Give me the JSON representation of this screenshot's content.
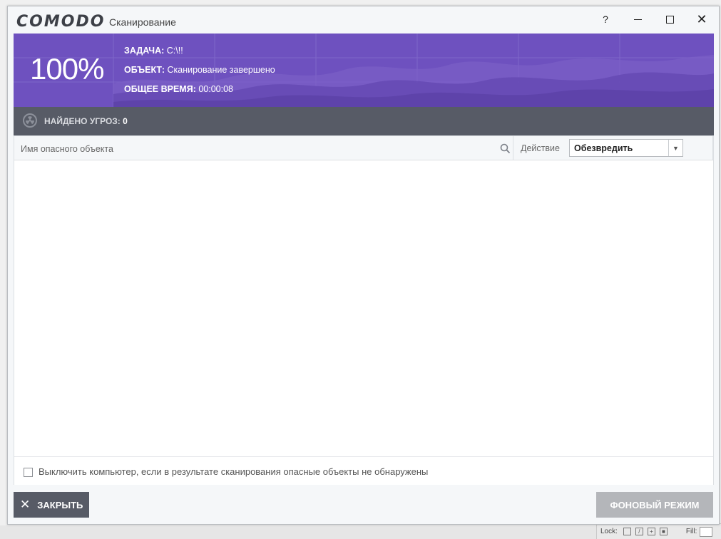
{
  "window": {
    "logo": "COMODO",
    "title": "Сканирование",
    "help": "?",
    "close": "✕"
  },
  "header": {
    "progress_text": "100%",
    "task_label": "ЗАДАЧА:",
    "task_value": "C:\\!!",
    "object_label": "ОБЪЕКТ:",
    "object_value": "Сканирование завершено",
    "time_label": "ОБЩЕЕ ВРЕМЯ:",
    "time_value": "00:00:08"
  },
  "threats": {
    "label": "НАЙДЕНО УГРОЗ:",
    "count": "0"
  },
  "table": {
    "name_column": "Имя опасного объекта",
    "action_column": "Действие",
    "action_selected": "Обезвредить",
    "rows": []
  },
  "options": {
    "shutdown_label": "Выключить компьютер, если в результате сканирования опасные объекты не обнаружены",
    "shutdown_checked": false
  },
  "buttons": {
    "close_icon": "✕",
    "close_label": "ЗАКРЫТЬ",
    "background_label": "ФОНОВЫЙ РЕЖИМ"
  },
  "background_app": {
    "lock_label": "Lock:",
    "fill_label": "Fill:"
  },
  "colors": {
    "accent_purple": "#6e51bf",
    "dark_bar": "#575b66",
    "disabled_button": "#b4b6ba"
  }
}
